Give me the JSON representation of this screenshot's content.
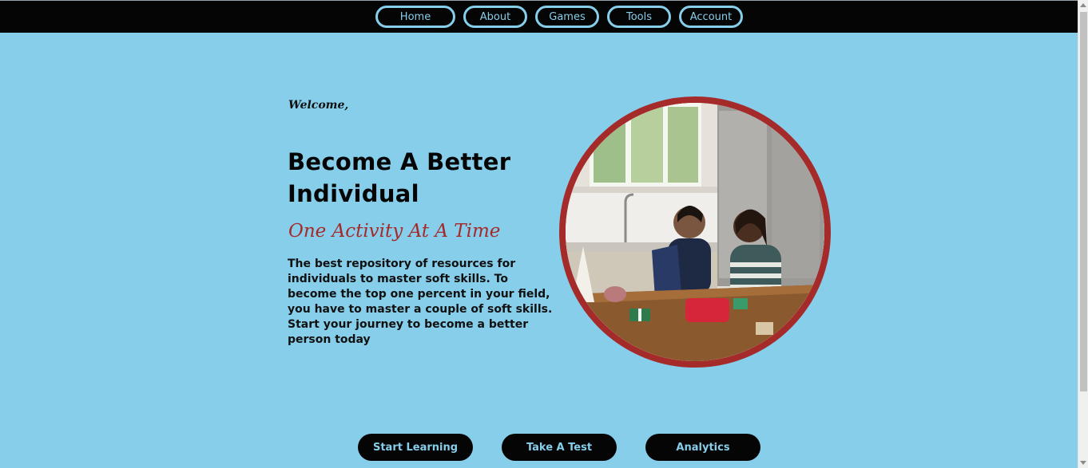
{
  "nav": {
    "items": [
      {
        "label": "Home"
      },
      {
        "label": "About"
      },
      {
        "label": "Games"
      },
      {
        "label": "Tools"
      },
      {
        "label": "Account"
      }
    ]
  },
  "hero": {
    "welcome": "Welcome,",
    "headline": "Become A Better Individual",
    "tagline": "One Activity At A Time",
    "description": "The best repository of resources for individuals to master soft skills. To become the top one percent in your field, you have to master a couple of soft skills. Start your journey to become a better person today",
    "image_alt": "Two women talking at a kitchen table with a laptop and wrapped gifts"
  },
  "actions": {
    "start_learning": "Start Learning",
    "take_test": "Take A Test",
    "analytics": "Analytics"
  },
  "colors": {
    "background": "#87ceeb",
    "nav_background": "#050505",
    "accent": "#a52a2a"
  }
}
